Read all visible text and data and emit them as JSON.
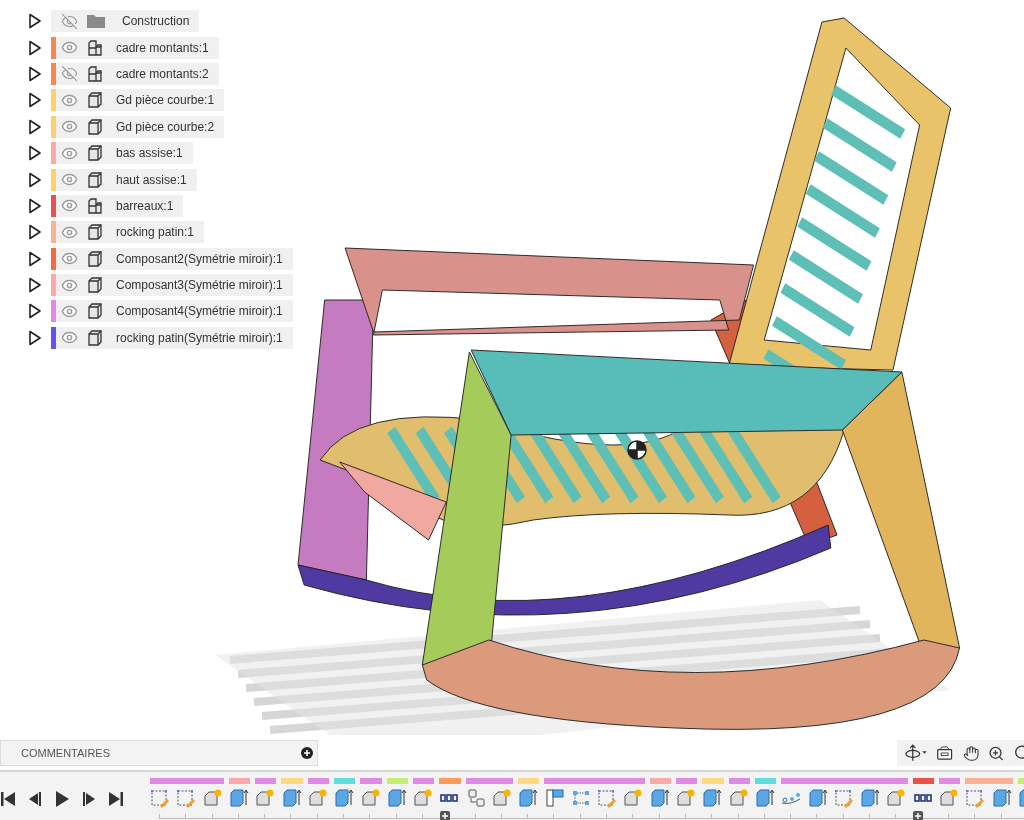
{
  "browser": {
    "items": [
      {
        "label": "Construction",
        "kind": "folder",
        "visible": false
      },
      {
        "label": "cadre montants:1",
        "kind": "assembly",
        "visible": true,
        "color": "#f5874f"
      },
      {
        "label": "cadre montants:2",
        "kind": "assembly",
        "visible": false,
        "color": "#f5874f"
      },
      {
        "label": "Gd pièce courbe:1",
        "kind": "body",
        "visible": true,
        "color": "#fdd06b"
      },
      {
        "label": "Gd pièce courbe:2",
        "kind": "body",
        "visible": true,
        "color": "#fdd06b"
      },
      {
        "label": "bas assise:1",
        "kind": "body",
        "visible": true,
        "color": "#fba8a8"
      },
      {
        "label": "haut assise:1",
        "kind": "body",
        "visible": true,
        "color": "#fdd06b"
      },
      {
        "label": "barreaux:1",
        "kind": "assembly",
        "visible": true,
        "color": "#e9514a"
      },
      {
        "label": "rocking patin:1",
        "kind": "body",
        "visible": true,
        "color": "#fbb193"
      },
      {
        "label": "Composant2(Symétrie miroir):1",
        "kind": "body",
        "visible": true,
        "color": "#f56a3e"
      },
      {
        "label": "Composant3(Symétrie miroir):1",
        "kind": "body",
        "visible": true,
        "color": "#fba8a8"
      },
      {
        "label": "Composant4(Symétrie miroir):1",
        "kind": "body",
        "visible": true,
        "color": "#e08ae4"
      },
      {
        "label": "rocking patin(Symétrie miroir):1",
        "kind": "body",
        "visible": true,
        "color": "#6550f2"
      }
    ]
  },
  "comments": {
    "title": "COMMENTAIRES"
  },
  "timeline": [
    {
      "kind": "sketch",
      "color": "#e08ae4"
    },
    {
      "kind": "sketch",
      "color": "#e08ae4"
    },
    {
      "kind": "component",
      "color": "#e08ae4"
    },
    {
      "kind": "extrude",
      "color": "#fba8a8"
    },
    {
      "kind": "component",
      "color": "#e08ae4"
    },
    {
      "kind": "extrude",
      "color": "#fdd880"
    },
    {
      "kind": "component",
      "color": "#e08ae4"
    },
    {
      "kind": "extrude",
      "color": "#5fdcdc"
    },
    {
      "kind": "component",
      "color": "#e08ae4"
    },
    {
      "kind": "extrude",
      "color": "#c3ee72"
    },
    {
      "kind": "component",
      "color": "#e08ae4"
    },
    {
      "kind": "pattern",
      "color": "#fb9a5a"
    },
    {
      "kind": "copy",
      "color": "#e08ae4"
    },
    {
      "kind": "component",
      "color": "#e08ae4"
    },
    {
      "kind": "extrude",
      "color": "#fdd880"
    },
    {
      "kind": "split",
      "color": "#e08ae4"
    },
    {
      "kind": "select",
      "color": "#e08ae4"
    },
    {
      "kind": "sketch",
      "color": "#e08ae4"
    },
    {
      "kind": "component",
      "color": "#e08ae4"
    },
    {
      "kind": "extrude",
      "color": "#fba8a8"
    },
    {
      "kind": "component",
      "color": "#e08ae4"
    },
    {
      "kind": "extrude",
      "color": "#fdd880"
    },
    {
      "kind": "component",
      "color": "#e08ae4"
    },
    {
      "kind": "extrude",
      "color": "#5fdcdc"
    },
    {
      "kind": "points",
      "color": "#e08ae4"
    },
    {
      "kind": "extrude",
      "color": "#e08ae4"
    },
    {
      "kind": "sketch",
      "color": "#e08ae4"
    },
    {
      "kind": "extrude",
      "color": "#e08ae4"
    },
    {
      "kind": "component",
      "color": "#e08ae4"
    },
    {
      "kind": "pattern",
      "color": "#e9514a"
    },
    {
      "kind": "component",
      "color": "#e08ae4"
    },
    {
      "kind": "sketch",
      "color": "#fbb193"
    },
    {
      "kind": "extrude",
      "color": "#fbb193"
    },
    {
      "kind": "extrude",
      "color": "#c3ee72"
    }
  ]
}
